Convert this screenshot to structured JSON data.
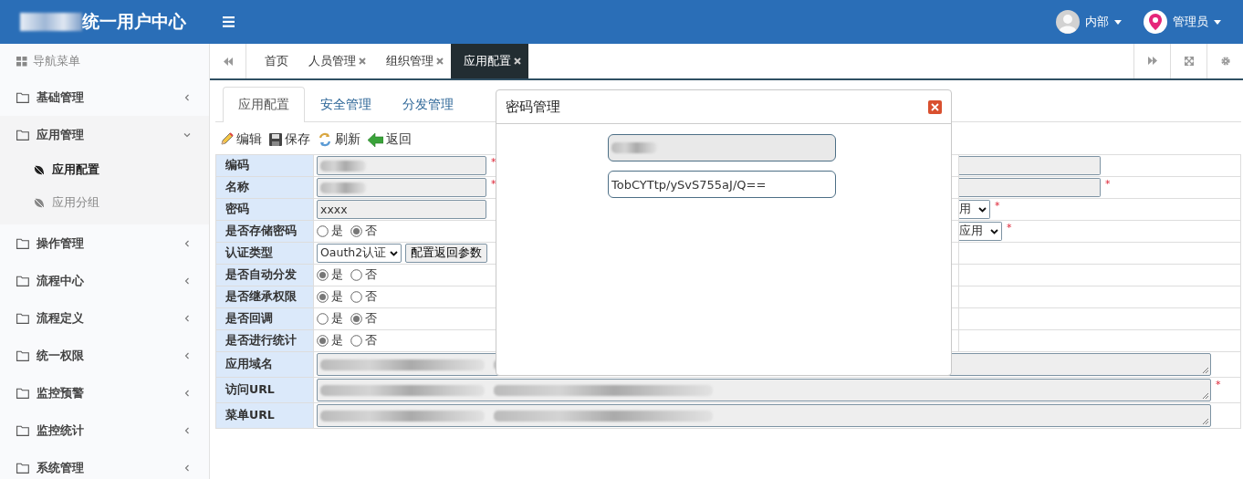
{
  "header": {
    "title": "统一用户中心",
    "title_redacted": true,
    "users": [
      {
        "label": "内部",
        "kind": "avatar"
      },
      {
        "label": "管理员",
        "kind": "pin"
      }
    ]
  },
  "sidebar": {
    "heading": "导航菜单",
    "items": [
      {
        "label": "基础管理",
        "expanded": false
      },
      {
        "label": "应用管理",
        "expanded": true,
        "children": [
          {
            "label": "应用配置",
            "selected": true
          },
          {
            "label": "应用分组",
            "selected": false
          }
        ]
      },
      {
        "label": "操作管理",
        "expanded": false
      },
      {
        "label": "流程中心",
        "expanded": false
      },
      {
        "label": "流程定义",
        "expanded": false
      },
      {
        "label": "统一权限",
        "expanded": false
      },
      {
        "label": "监控预警",
        "expanded": false
      },
      {
        "label": "监控统计",
        "expanded": false
      },
      {
        "label": "系统管理",
        "expanded": false
      }
    ]
  },
  "tabs": [
    {
      "label": "首页",
      "selected": false,
      "closable": false
    },
    {
      "label": "人员管理",
      "selected": false,
      "closable": true
    },
    {
      "label": "组织管理",
      "selected": false,
      "closable": true
    },
    {
      "label": "应用配置",
      "selected": true,
      "closable": true
    }
  ],
  "subtabs": [
    {
      "label": "应用配置",
      "selected": true
    },
    {
      "label": "安全管理",
      "selected": false
    },
    {
      "label": "分发管理",
      "selected": false
    }
  ],
  "toolbar": [
    {
      "label": "编辑",
      "kind": "edit"
    },
    {
      "label": "保存",
      "kind": "save"
    },
    {
      "label": "刷新",
      "kind": "refresh"
    },
    {
      "label": "返回",
      "kind": "back"
    }
  ],
  "form": [
    {
      "label": "编码",
      "kind": "text",
      "redacted": true,
      "mark": "*",
      "right": {
        "kind": "text"
      }
    },
    {
      "label": "名称",
      "kind": "text",
      "redacted": true,
      "mark": "*",
      "right": {
        "kind": "text",
        "mark": "*"
      }
    },
    {
      "label": "密码",
      "kind": "text",
      "value": "xxxx",
      "right": {
        "kind": "select",
        "value": "用",
        "mark": "*"
      }
    },
    {
      "label": "是否存储密码",
      "kind": "radio",
      "options": [
        {
          "label": "是",
          "selected": false
        },
        {
          "label": "否",
          "selected": true
        }
      ],
      "right": {
        "kind": "select",
        "value": "应用",
        "mark": "*"
      }
    },
    {
      "label": "认证类型",
      "kind": "select",
      "value": "Oauth2认证",
      "button": "配置返回参数"
    },
    {
      "label": "是否自动分发",
      "kind": "radio",
      "options": [
        {
          "label": "是",
          "selected": true
        },
        {
          "label": "否",
          "selected": false
        }
      ]
    },
    {
      "label": "是否继承权限",
      "kind": "radio",
      "options": [
        {
          "label": "是",
          "selected": true
        },
        {
          "label": "否",
          "selected": false
        }
      ]
    },
    {
      "label": "是否回调",
      "kind": "radio",
      "options": [
        {
          "label": "是",
          "selected": false
        },
        {
          "label": "否",
          "selected": true
        }
      ]
    },
    {
      "label": "是否进行统计",
      "kind": "radio",
      "options": [
        {
          "label": "是",
          "selected": true
        },
        {
          "label": "否",
          "selected": false
        }
      ]
    },
    {
      "label": "应用域名",
      "kind": "textarea",
      "redacted": true
    },
    {
      "label": "访问URL",
      "kind": "textarea",
      "redacted": true,
      "mark": "*"
    },
    {
      "label": "菜单URL",
      "kind": "textarea",
      "redacted": true
    }
  ],
  "dialog": {
    "title": "密码管理",
    "fields": [
      {
        "redacted": true,
        "disabled": true
      },
      {
        "value": "TobCYTtp/ySvS755aJ/Q==",
        "disabled": false
      }
    ]
  }
}
